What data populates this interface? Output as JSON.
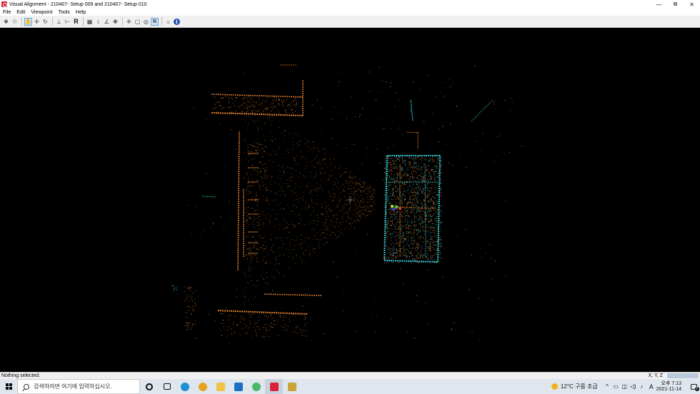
{
  "window": {
    "title": "Visual Alignment - 210407- Setup 009 and 210407- Setup 010",
    "controls": {
      "minimize": "—",
      "restore": "⧉",
      "close": "✕"
    }
  },
  "menu": [
    "File",
    "Edit",
    "Viewpoint",
    "Tools",
    "Help"
  ],
  "toolbar": {
    "buttons": [
      {
        "icon": "auto-align-icon",
        "glyph": "❖",
        "active": false
      },
      {
        "icon": "refine-icon",
        "glyph": "☉",
        "active": false
      },
      {
        "icon": "select-hand-icon",
        "glyph": "✋",
        "active": true
      },
      {
        "icon": "move-icon",
        "glyph": "✛",
        "active": false
      },
      {
        "icon": "rotate-icon",
        "glyph": "↻",
        "active": false
      },
      {
        "icon": "top-view-icon",
        "glyph": "⊥",
        "active": false
      },
      {
        "icon": "side-view-icon",
        "glyph": "⊢",
        "active": false
      },
      {
        "icon": "reset-icon",
        "glyph": "R",
        "active": false
      },
      {
        "icon": "points-icon",
        "glyph": "▦",
        "active": false
      },
      {
        "icon": "vertical-icon",
        "glyph": "↕",
        "active": false
      },
      {
        "icon": "angle-icon",
        "glyph": "∠",
        "active": false
      },
      {
        "icon": "pan-icon",
        "glyph": "✥",
        "active": false
      },
      {
        "icon": "orbit-icon",
        "glyph": "❈",
        "active": false
      },
      {
        "icon": "zoom-box-icon",
        "glyph": "▢",
        "active": false
      },
      {
        "icon": "zoom-extents-icon",
        "glyph": "◎",
        "active": false
      },
      {
        "icon": "slice-icon",
        "glyph": "⧉",
        "active": true
      },
      {
        "icon": "color-icon",
        "glyph": "☼",
        "active": false
      },
      {
        "icon": "info-icon",
        "glyph": "i",
        "active": false
      }
    ]
  },
  "viewport": {
    "background": "#000000",
    "scan_colors": {
      "scan_a": "#e8842c",
      "scan_b": "#2bc8d6"
    }
  },
  "status": {
    "text": "Nothing selected.",
    "coords_label": "X, Y, Z"
  },
  "taskbar": {
    "search_placeholder": "검색하려면 여기에 입력하십시오.",
    "apps": [
      {
        "name": "cortana-icon",
        "color": "#ffffff"
      },
      {
        "name": "task-view-icon",
        "color": "#ffffff"
      },
      {
        "name": "edge-icon",
        "color": "#1e8fd6"
      },
      {
        "name": "chrome-icon",
        "color": "#e5a21d"
      },
      {
        "name": "file-explorer-icon",
        "color": "#f0c24a"
      },
      {
        "name": "mail-icon",
        "color": "#1d6fc2"
      },
      {
        "name": "maps-icon",
        "color": "#4cb86a"
      },
      {
        "name": "visual-alignment-app-icon",
        "color": "#d8223a"
      },
      {
        "name": "pen-app-icon",
        "color": "#c9a23a"
      }
    ],
    "weather": "12°C 구름 조금",
    "ime": "A",
    "time": "오후 7:13",
    "date": "2021-11-14",
    "notifications": "2"
  }
}
